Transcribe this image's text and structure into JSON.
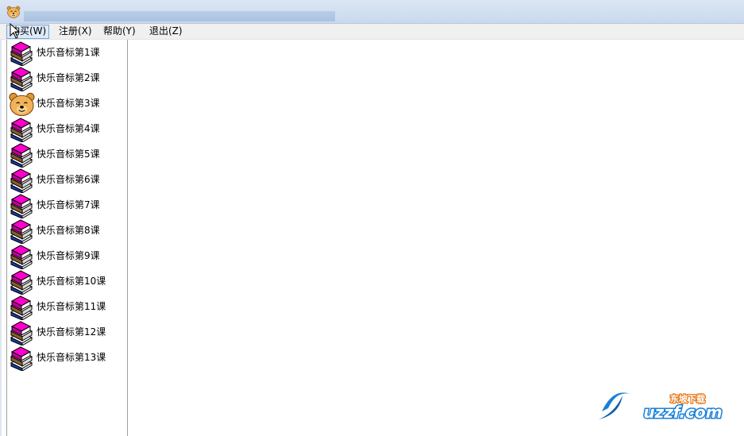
{
  "menu": {
    "items": [
      {
        "label": "购买(W)"
      },
      {
        "label": "注册(X)"
      },
      {
        "label": "帮助(Y)"
      },
      {
        "label": "退出(Z)"
      }
    ]
  },
  "lessons": [
    {
      "label": "快乐音标第1课",
      "icon": "book-icon"
    },
    {
      "label": "快乐音标第2课",
      "icon": "book-icon"
    },
    {
      "label": "快乐音标第3课",
      "icon": "bear-icon"
    },
    {
      "label": "快乐音标第4课",
      "icon": "book-icon"
    },
    {
      "label": "快乐音标第5课",
      "icon": "book-icon"
    },
    {
      "label": "快乐音标第6课",
      "icon": "book-icon"
    },
    {
      "label": "快乐音标第7课",
      "icon": "book-icon"
    },
    {
      "label": "快乐音标第8课",
      "icon": "book-icon"
    },
    {
      "label": "快乐音标第9课",
      "icon": "book-icon"
    },
    {
      "label": "快乐音标第10课",
      "icon": "book-icon"
    },
    {
      "label": "快乐音标第11课",
      "icon": "book-icon"
    },
    {
      "label": "快乐音标第12课",
      "icon": "book-icon"
    },
    {
      "label": "快乐音标第13课",
      "icon": "book-icon"
    }
  ],
  "watermark": {
    "text": "uzzf.com",
    "subtext": "东坡下载"
  },
  "colors": {
    "book": "#ff00cc",
    "book_spine": "#1a3ca8",
    "bear": "#f2b25a",
    "titlebar": "#c9d9ee"
  }
}
